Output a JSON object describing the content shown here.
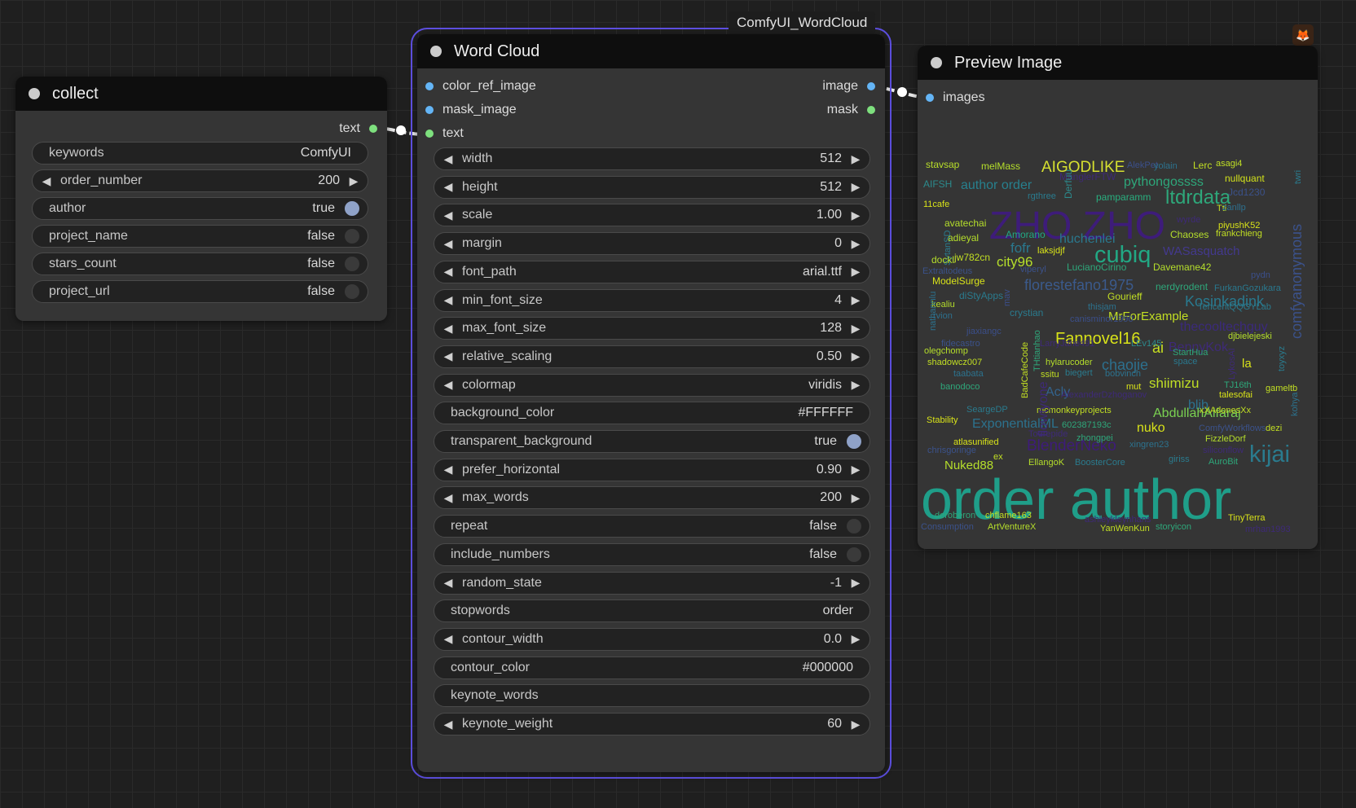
{
  "canvas": {
    "grid_color": "#2a2a2a",
    "background": "#1f1f1f"
  },
  "collect_node": {
    "title": "collect",
    "output_label": "text",
    "widgets": [
      {
        "label": "keywords",
        "value": "ComfyUI"
      },
      {
        "label": "order_number",
        "value": "200"
      },
      {
        "label": "author",
        "value": "true"
      },
      {
        "label": "project_name",
        "value": "false"
      },
      {
        "label": "stars_count",
        "value": "false"
      },
      {
        "label": "project_url",
        "value": "false"
      }
    ]
  },
  "wordcloud_node": {
    "title": "Word Cloud",
    "badge": "ComfyUI_WordCloud",
    "accent_border": "#5d4fe0",
    "inputs": [
      "color_ref_image",
      "mask_image",
      "text"
    ],
    "outputs": [
      "image",
      "mask"
    ],
    "widgets": [
      {
        "label": "width",
        "value": "512"
      },
      {
        "label": "height",
        "value": "512"
      },
      {
        "label": "scale",
        "value": "1.00"
      },
      {
        "label": "margin",
        "value": "0"
      },
      {
        "label": "font_path",
        "value": "arial.ttf"
      },
      {
        "label": "min_font_size",
        "value": "4"
      },
      {
        "label": "max_font_size",
        "value": "128"
      },
      {
        "label": "relative_scaling",
        "value": "0.50"
      },
      {
        "label": "colormap",
        "value": "viridis"
      },
      {
        "label": "background_color",
        "value": "#FFFFFF"
      },
      {
        "label": "transparent_background",
        "value": "true"
      },
      {
        "label": "prefer_horizontal",
        "value": "0.90"
      },
      {
        "label": "max_words",
        "value": "200"
      },
      {
        "label": "repeat",
        "value": "false"
      },
      {
        "label": "include_numbers",
        "value": "false"
      },
      {
        "label": "random_state",
        "value": "-1"
      },
      {
        "label": "stopwords",
        "value": "order"
      },
      {
        "label": "contour_width",
        "value": "0.0"
      },
      {
        "label": "contour_color",
        "value": "#000000"
      },
      {
        "label": "keynote_words",
        "value": ""
      },
      {
        "label": "keynote_weight",
        "value": "60"
      }
    ]
  },
  "preview_node": {
    "title": "Preview Image",
    "input_label": "images",
    "cloud_words": [
      {
        "t": "order author",
        "c": "#1f9e89"
      },
      {
        "t": "ZHO ZHO",
        "c": "#3e1c7a"
      },
      {
        "t": "AIGODLIKE",
        "c": "#d6e030"
      },
      {
        "t": "ltdrdata",
        "c": "#2ea77a"
      },
      {
        "t": "cubiq",
        "c": "#22a884"
      },
      {
        "t": "kijai",
        "c": "#2a7b8e"
      },
      {
        "t": "florestefano1975",
        "c": "#3b5a8c"
      },
      {
        "t": "Fannovel16",
        "c": "#d8e219"
      },
      {
        "t": "Kosinkadink",
        "c": "#29798e"
      },
      {
        "t": "MrForExample",
        "c": "#c2df23"
      },
      {
        "t": "BlenderNeko",
        "c": "#3e1c7a"
      },
      {
        "t": "AbdullahAlfaraj",
        "c": "#7ad151"
      },
      {
        "t": "ExponentialML",
        "c": "#2c728e"
      },
      {
        "t": "pythongossss",
        "c": "#2ea77a"
      },
      {
        "t": "author order",
        "c": "#27808e"
      },
      {
        "t": "huchenlei",
        "c": "#2a788e"
      },
      {
        "t": "WASasquatch",
        "c": "#43398e"
      },
      {
        "t": "thecooltechguy",
        "c": "#3b2a7c"
      },
      {
        "t": "chaojie",
        "c": "#2d708e"
      },
      {
        "t": "shiimizu",
        "c": "#c0df25"
      },
      {
        "t": "comfyanonymous",
        "c": "#3b528b"
      },
      {
        "t": "city96",
        "c": "#b5de2b"
      },
      {
        "t": "fofr",
        "c": "#2a788e"
      },
      {
        "t": "nuko",
        "c": "#d8e219"
      },
      {
        "t": "ai",
        "c": "#c8e020"
      },
      {
        "t": "BennyKok",
        "c": "#3e2a78"
      },
      {
        "t": "Acly",
        "c": "#33638d"
      },
      {
        "t": "blib",
        "c": "#2c728e"
      },
      {
        "t": "Nuked88",
        "c": "#b5de2b"
      },
      {
        "t": "stavsap",
        "c": "#b8de29"
      },
      {
        "t": "melMass",
        "c": "#b5de2b"
      },
      {
        "t": "AlekPet",
        "c": "#3b4f8a"
      },
      {
        "t": "yolain",
        "c": "#2c728e"
      },
      {
        "t": "Lerc",
        "c": "#c2df23"
      },
      {
        "t": "asagi4",
        "c": "#c0df25"
      },
      {
        "t": "AIFSH",
        "c": "#2c8a8c"
      },
      {
        "t": "ManglerFTW",
        "c": "#3e2a78"
      },
      {
        "t": "nullquant",
        "c": "#d2e21b"
      },
      {
        "t": "Derfuu",
        "c": "#2c8a8c"
      },
      {
        "t": "rgthree",
        "c": "#2a7b8e"
      },
      {
        "t": "pamparamm",
        "c": "#29af7f"
      },
      {
        "t": "Jcd1230",
        "c": "#3b528b"
      },
      {
        "t": "twri",
        "c": "#2a7b8e"
      },
      {
        "t": "11cafe",
        "c": "#d8e219"
      },
      {
        "t": "Ttl",
        "c": "#c2df23"
      },
      {
        "t": "zanllp",
        "c": "#2d708e"
      },
      {
        "t": "SytanSD",
        "c": "#2a7b8e"
      },
      {
        "t": "avatechai",
        "c": "#b5de2b"
      },
      {
        "t": "wyrde",
        "c": "#3e2a78"
      },
      {
        "t": "piyushK52",
        "c": "#d8e219"
      },
      {
        "t": "adieyal",
        "c": "#b5de2b"
      },
      {
        "t": "Amorano",
        "c": "#22a884"
      },
      {
        "t": "Chaoses",
        "c": "#b5de2b"
      },
      {
        "t": "frankchieng",
        "c": "#c2df23"
      },
      {
        "t": "laksjdjf",
        "c": "#d8e219"
      },
      {
        "t": "dockl",
        "c": "#b5de2b"
      },
      {
        "t": "jw782cn",
        "c": "#c2df23"
      },
      {
        "t": "LucianoCirino",
        "c": "#2ea77a"
      },
      {
        "t": "Davemane42",
        "c": "#b5de2b"
      },
      {
        "t": "Extraltodeus",
        "c": "#3b528b"
      },
      {
        "t": "viperyl",
        "c": "#3b528b"
      },
      {
        "t": "pydn",
        "c": "#3b4f8a"
      },
      {
        "t": "ModelSurge",
        "c": "#d8e219"
      },
      {
        "t": "nerdyrodent",
        "c": "#2ea77a"
      },
      {
        "t": "FurkanGozukara",
        "c": "#2a788e"
      },
      {
        "t": "diStyApps",
        "c": "#2a7b8e"
      },
      {
        "t": "Gourieff",
        "c": "#c2df23"
      },
      {
        "t": "TencentQQGYLab",
        "c": "#2a7b8e"
      },
      {
        "t": "kealiu",
        "c": "#b5de2b"
      },
      {
        "t": "thisjam",
        "c": "#2c728e"
      },
      {
        "t": "crystian",
        "c": "#2a7b8e"
      },
      {
        "t": "rvion",
        "c": "#2d708e"
      },
      {
        "t": "canisminor1990",
        "c": "#3b4f8a"
      },
      {
        "t": "nathannlu",
        "c": "#2c728e"
      },
      {
        "t": "jiaxiangc",
        "c": "#3b4f8a"
      },
      {
        "t": "djbielejeski",
        "c": "#b5de2b"
      },
      {
        "t": "fidecastro",
        "c": "#3b528b"
      },
      {
        "t": "LarryJane491",
        "c": "#3e2a78"
      },
      {
        "t": "LEv145",
        "c": "#2c8a8c"
      },
      {
        "t": "olegchomp",
        "c": "#b5de2b"
      },
      {
        "t": "StartHua",
        "c": "#2ea77a"
      },
      {
        "t": "toyxyz",
        "c": "#2a7b8e"
      },
      {
        "t": "shadowcz007",
        "c": "#c2df23"
      },
      {
        "t": "hylarucoder",
        "c": "#b5de2b"
      },
      {
        "t": "space",
        "c": "#2a788e"
      },
      {
        "t": "la",
        "c": "#d8e219"
      },
      {
        "t": "taabata",
        "c": "#2c728e"
      },
      {
        "t": "ssitu",
        "c": "#c2df23"
      },
      {
        "t": "biegert",
        "c": "#2a7b8e"
      },
      {
        "t": "bobvinch",
        "c": "#2c728e"
      },
      {
        "t": "TJ16th",
        "c": "#2ea77a"
      },
      {
        "t": "banodoco",
        "c": "#2ea77a"
      },
      {
        "t": "mut",
        "c": "#d8e219"
      },
      {
        "t": "gameltb",
        "c": "#c2df23"
      },
      {
        "t": "talesofai",
        "c": "#d8e219"
      },
      {
        "t": "AlexanderDzhoganov",
        "c": "#3e2a78"
      },
      {
        "t": "SeargeDP",
        "c": "#2a7b8e"
      },
      {
        "t": "xXAdonesXx",
        "c": "#c2df23"
      },
      {
        "t": "kohya",
        "c": "#2c728e"
      },
      {
        "t": "mcmonkeyprojects",
        "c": "#c2df23"
      },
      {
        "t": "Stability",
        "c": "#d8e219"
      },
      {
        "t": "602387193c",
        "c": "#2ea77a"
      },
      {
        "t": "ComfyWorkflows",
        "c": "#3b528b"
      },
      {
        "t": "dezi",
        "c": "#c2df23"
      },
      {
        "t": "atlasunified",
        "c": "#d8e219"
      },
      {
        "t": "Tourepide",
        "c": "#3e2a78"
      },
      {
        "t": "zhongpei",
        "c": "#2ea77a"
      },
      {
        "t": "FizzleDorf",
        "c": "#b5de2b"
      },
      {
        "t": "chrisgoringe",
        "c": "#3b528b"
      },
      {
        "t": "xingren23",
        "c": "#2c728e"
      },
      {
        "t": "siliconflow",
        "c": "#3e2a78"
      },
      {
        "t": "ex",
        "c": "#c2df23"
      },
      {
        "t": "giriss",
        "c": "#2a7b8e"
      },
      {
        "t": "EllangoK",
        "c": "#b5de2b"
      },
      {
        "t": "BoosterCore",
        "c": "#2a7b8e"
      },
      {
        "t": "AuroBit",
        "c": "#2ea77a"
      },
      {
        "t": "deroberon",
        "c": "#2ea77a"
      },
      {
        "t": "chflame163",
        "c": "#c2df23"
      },
      {
        "t": "ashleykleynhans",
        "c": "#3e2a78"
      },
      {
        "t": "TinyTerra",
        "c": "#d8e219"
      },
      {
        "t": "Consumption",
        "c": "#3b528b"
      },
      {
        "t": "ArtVentureX",
        "c": "#b5de2b"
      },
      {
        "t": "YanWenKun",
        "c": "#c2df23"
      },
      {
        "t": "storyicon",
        "c": "#2ea77a"
      },
      {
        "t": "mrhan1993",
        "c": "#3e2a78"
      },
      {
        "t": "BadCafeCode",
        "c": "#c2df23"
      },
      {
        "t": "THtianhao",
        "c": "#2ea77a"
      },
      {
        "t": "flowtyone",
        "c": "#3e2a78"
      },
      {
        "t": "mav",
        "c": "#3b4f8a"
      },
      {
        "t": "LykosAI",
        "c": "#3e2a78"
      }
    ]
  }
}
